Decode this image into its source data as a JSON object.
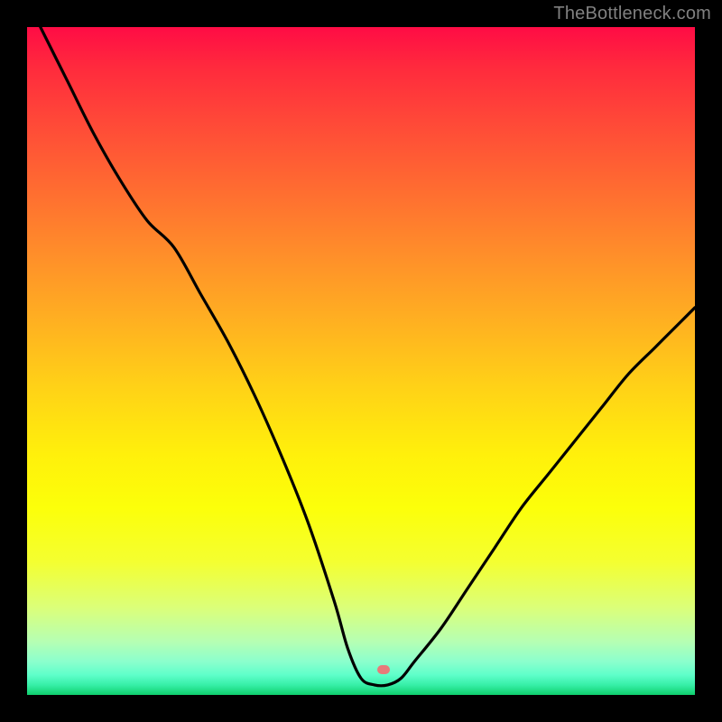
{
  "watermark": "TheBottleneck.com",
  "marker": {
    "x_frac": 0.534,
    "y_frac": 0.962
  },
  "chart_data": {
    "type": "line",
    "title": "",
    "xlabel": "",
    "ylabel": "",
    "xlim": [
      0,
      100
    ],
    "ylim": [
      0,
      100
    ],
    "x": [
      2,
      6,
      10,
      14,
      18,
      22,
      26,
      30,
      34,
      38,
      42,
      46,
      48,
      50,
      52,
      54,
      56,
      58,
      62,
      66,
      70,
      74,
      78,
      82,
      86,
      90,
      94,
      98,
      100
    ],
    "values": [
      100,
      92,
      84,
      77,
      71,
      67,
      60,
      53,
      45,
      36,
      26,
      14,
      7,
      2.5,
      1.5,
      1.5,
      2.5,
      5,
      10,
      16,
      22,
      28,
      33,
      38,
      43,
      48,
      52,
      56,
      58
    ],
    "note": "Bottleneck-style curve: y-axis inverted visually (higher value = higher on plot = more red). Minimum (best) near x≈53."
  }
}
